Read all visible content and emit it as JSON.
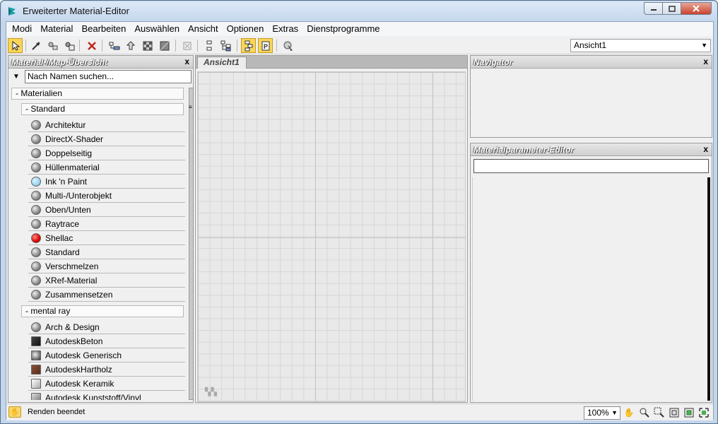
{
  "window": {
    "title": "Erweiterter Material-Editor",
    "minimize": "–",
    "maximize": "□",
    "close": "x"
  },
  "menu": [
    "Modi",
    "Material",
    "Bearbeiten",
    "Auswählen",
    "Ansicht",
    "Optionen",
    "Extras",
    "Dienstprogramme"
  ],
  "toolbar": {
    "view_select": "Ansicht1",
    "icons": [
      "select-arrow-icon",
      "eyedropper-icon",
      "assign-material-icon",
      "put-to-library-icon",
      "delete-icon",
      "layout-children-icon",
      "move-children-icon",
      "checker-preview-icon",
      "background-icon",
      "show-map-icon",
      "show-in-viewport-icon",
      "layout-all-icon",
      "hide-unused-icon",
      "show-end-result-icon",
      "parameter-editor-icon",
      "select-by-material-icon"
    ]
  },
  "browser": {
    "title": "Material-/Map-Übersicht",
    "close": "x",
    "search_placeholder": "Nach Namen suchen...",
    "group1": "- Materialien",
    "sub1": "- Standard",
    "standard_items": [
      {
        "label": "Architektur",
        "swatch": "sphere"
      },
      {
        "label": "DirectX-Shader",
        "swatch": "sphere"
      },
      {
        "label": "Doppelseitig",
        "swatch": "sphere"
      },
      {
        "label": "Hüllenmaterial",
        "swatch": "sphere"
      },
      {
        "label": "Ink 'n Paint",
        "swatch": "blue"
      },
      {
        "label": "Multi-/Unterobjekt",
        "swatch": "sphere"
      },
      {
        "label": "Oben/Unten",
        "swatch": "sphere"
      },
      {
        "label": "Raytrace",
        "swatch": "sphere"
      },
      {
        "label": "Shellac",
        "swatch": "red"
      },
      {
        "label": "Standard",
        "swatch": "sphere"
      },
      {
        "label": "Verschmelzen",
        "swatch": "sphere"
      },
      {
        "label": "XRef-Material",
        "swatch": "sphere"
      },
      {
        "label": "Zusammensetzen",
        "swatch": "sphere"
      }
    ],
    "sub2": "- mental ray",
    "mentalray_items": [
      {
        "label": "Arch & Design",
        "swatch": "sphere"
      },
      {
        "label": "AutodeskBeton",
        "swatch": "dark"
      },
      {
        "label": "Autodesk Generisch",
        "swatch": "gen"
      },
      {
        "label": "AutodeskHartholz",
        "swatch": "wood"
      },
      {
        "label": "Autodesk Keramik",
        "swatch": "cer"
      },
      {
        "label": "Autodesk Kunststoff/Vinyl",
        "swatch": "box"
      }
    ]
  },
  "view": {
    "tab": "Ansicht1"
  },
  "navigator": {
    "title": "Navigator",
    "close": "x"
  },
  "param_editor": {
    "title": "Materialparameter-Editor",
    "close": "x"
  },
  "status": {
    "text": "Renden beendet",
    "zoom": "100%"
  },
  "colors": {
    "active_button": "#f9d65a",
    "title_gradient_top": "#dbe8f6",
    "panel_bg": "#f0f0f0"
  }
}
